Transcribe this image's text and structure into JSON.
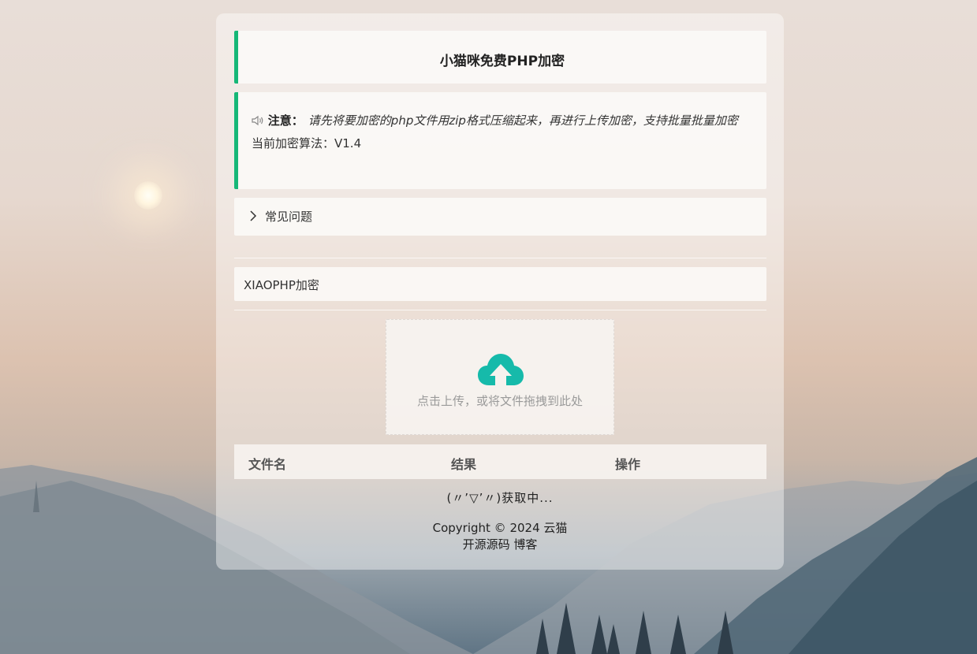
{
  "header": {
    "title": "小猫咪免费PHP加密"
  },
  "notice": {
    "label": "注意：",
    "message": "请先将要加密的php文件用zip格式压缩起来，再进行上传加密，支持批量批量加密",
    "version": "当前加密算法：V1.4"
  },
  "faq": {
    "label": "常见问题"
  },
  "mode": {
    "label": "XIAOPHP加密"
  },
  "upload": {
    "hint": "点击上传，或将文件拖拽到此处",
    "icon": "cloud-upload-icon",
    "icon_color": "#16baaa"
  },
  "table": {
    "columns": [
      "文件名",
      "结果",
      "操作"
    ]
  },
  "status": {
    "loading": "(〃’▽’〃)获取中..."
  },
  "footer": {
    "copyright": "Copyright © 2024 云猫",
    "links": [
      "开源源码",
      "博客"
    ]
  },
  "colors": {
    "accent": "#16b777"
  }
}
